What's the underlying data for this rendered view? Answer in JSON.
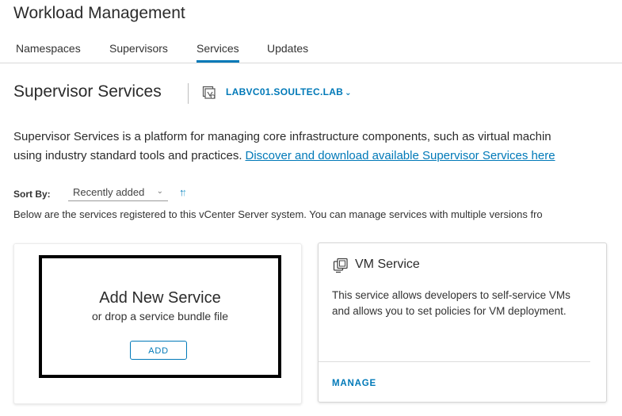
{
  "page": {
    "title": "Workload Management"
  },
  "tabs": [
    {
      "label": "Namespaces"
    },
    {
      "label": "Supervisors"
    },
    {
      "label": "Services"
    },
    {
      "label": "Updates"
    }
  ],
  "active_tab": "Services",
  "section": {
    "title": "Supervisor Services",
    "vcenter_selector": {
      "label": "LABVC01.SOULTEC.LAB",
      "icon": "vcenter-icon",
      "caret_icon": "chevron-down-icon"
    }
  },
  "intro": {
    "line1": "Supervisor Services is a platform for managing core infrastructure components, such as virtual machin",
    "line2": "using industry standard tools and practices.",
    "link": "Discover and download available Supervisor Services here"
  },
  "sort": {
    "label": "Sort By:",
    "selected": "Recently added",
    "direction_icon": "sort-direction-icon"
  },
  "below_text": "Below are the services registered to this vCenter Server system. You can manage services with multiple versions fro",
  "add_card": {
    "title": "Add New Service",
    "subtitle": "or drop a service bundle file",
    "button": "ADD"
  },
  "vm_service_card": {
    "icon": "vm-service-icon",
    "title": "VM Service",
    "description": "This service allows developers to self-service VMs and allows you to set policies for VM deployment.",
    "action": "MANAGE"
  },
  "colors": {
    "accent": "#0079b8",
    "text": "#333333",
    "border": "#d8d8d8"
  }
}
